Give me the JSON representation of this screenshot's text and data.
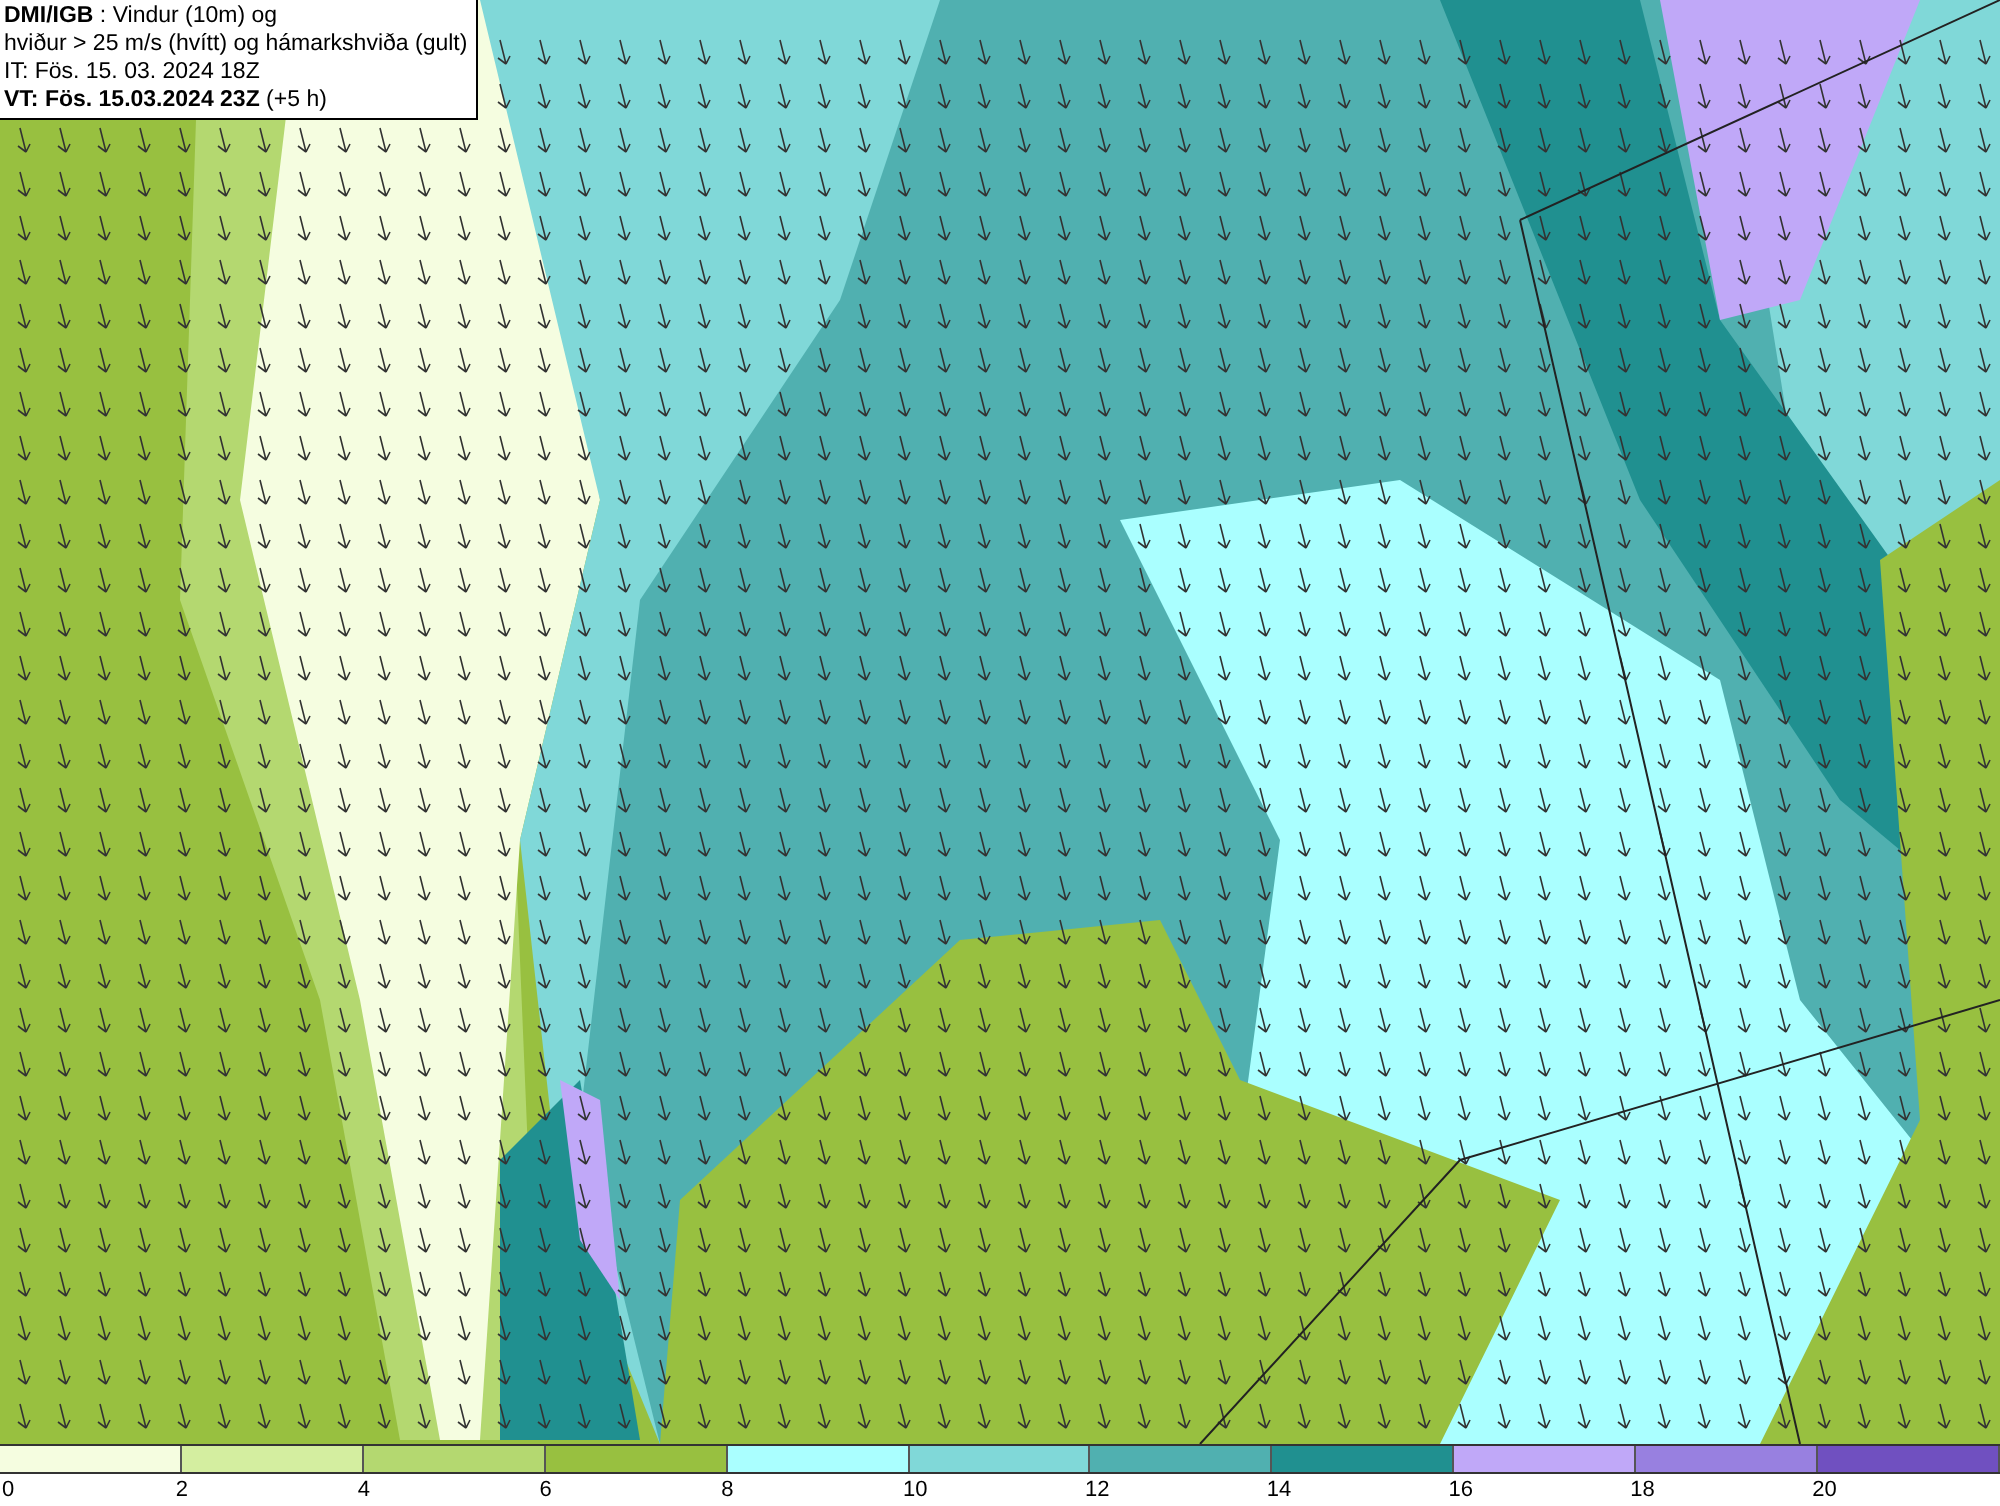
{
  "info_box": {
    "lines": [
      "**DMI/IGB** : Vindur (10m) og",
      "hviður > 25 m/s (hvítt) og hámarkshviða (gult)",
      "IT: Fös. 15. 03. 2024 18Z",
      "**VT: Fös. 15.03.2024 23Z** (+5 h)"
    ]
  },
  "colorbar": {
    "segments": [
      {
        "color": "#f5fde0"
      },
      {
        "color": "#d4eea0"
      },
      {
        "color": "#b4d870"
      },
      {
        "color": "#98c040"
      },
      {
        "color": "#aaffff"
      },
      {
        "color": "#80d8d8"
      },
      {
        "color": "#50b0b0"
      },
      {
        "color": "#209090"
      },
      {
        "color": "#c0a8f8"
      },
      {
        "color": "#9880e0"
      },
      {
        "color": "#7050c0"
      }
    ],
    "ticks": [
      "0",
      "2",
      "4",
      "6",
      "8",
      "10",
      "12",
      "14",
      "16",
      "18",
      "20"
    ]
  }
}
